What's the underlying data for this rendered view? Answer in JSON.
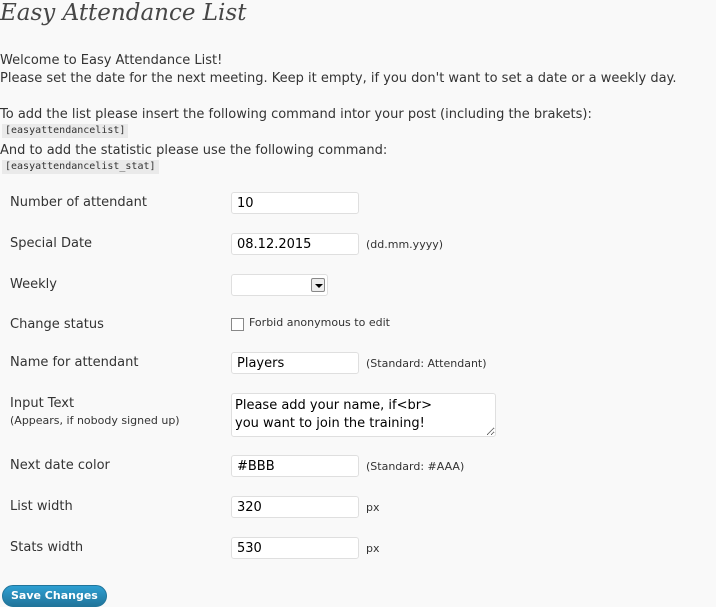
{
  "page": {
    "title": "Easy Attendance List",
    "intro_line1": "Welcome to Easy Attendance List!",
    "intro_line2": "Please set the date for the next meeting. Keep it empty, if you don't want to set a date or a weekly day.",
    "insert_line": "To add the list please insert the following command intor your post (including the brakets):",
    "list_command": "[easyattendancelist]",
    "stat_line": "And to add the statistic please use the following command:",
    "stat_command": "[easyattendancelist_stat]"
  },
  "form": {
    "number_of_attendant": {
      "label": "Number of attendant",
      "value": "10"
    },
    "special_date": {
      "label": "Special Date",
      "value": "08.12.2015",
      "hint": "(dd.mm.yyyy)"
    },
    "weekly": {
      "label": "Weekly",
      "value": ""
    },
    "change_status": {
      "label": "Change status",
      "checkbox_label": "Forbid anonymous to edit",
      "checked": false
    },
    "name_for_attendant": {
      "label": "Name for attendant",
      "value": "Players",
      "hint": "(Standard: Attendant)"
    },
    "input_text": {
      "label": "Input Text",
      "sublabel": "(Appears, if nobody signed up)",
      "value": "Please add your name, if<br>\nyou want to join the training!"
    },
    "next_date_color": {
      "label": "Next date color",
      "value": "#BBB",
      "hint": "(Standard: #AAA)"
    },
    "list_width": {
      "label": "List width",
      "value": "320",
      "unit": "px"
    },
    "stats_width": {
      "label": "Stats width",
      "value": "530",
      "unit": "px"
    }
  },
  "buttons": {
    "save_label": "Save Changes"
  },
  "colors": {
    "button_bg": "#21759b",
    "page_bg": "#f9f9f9"
  }
}
